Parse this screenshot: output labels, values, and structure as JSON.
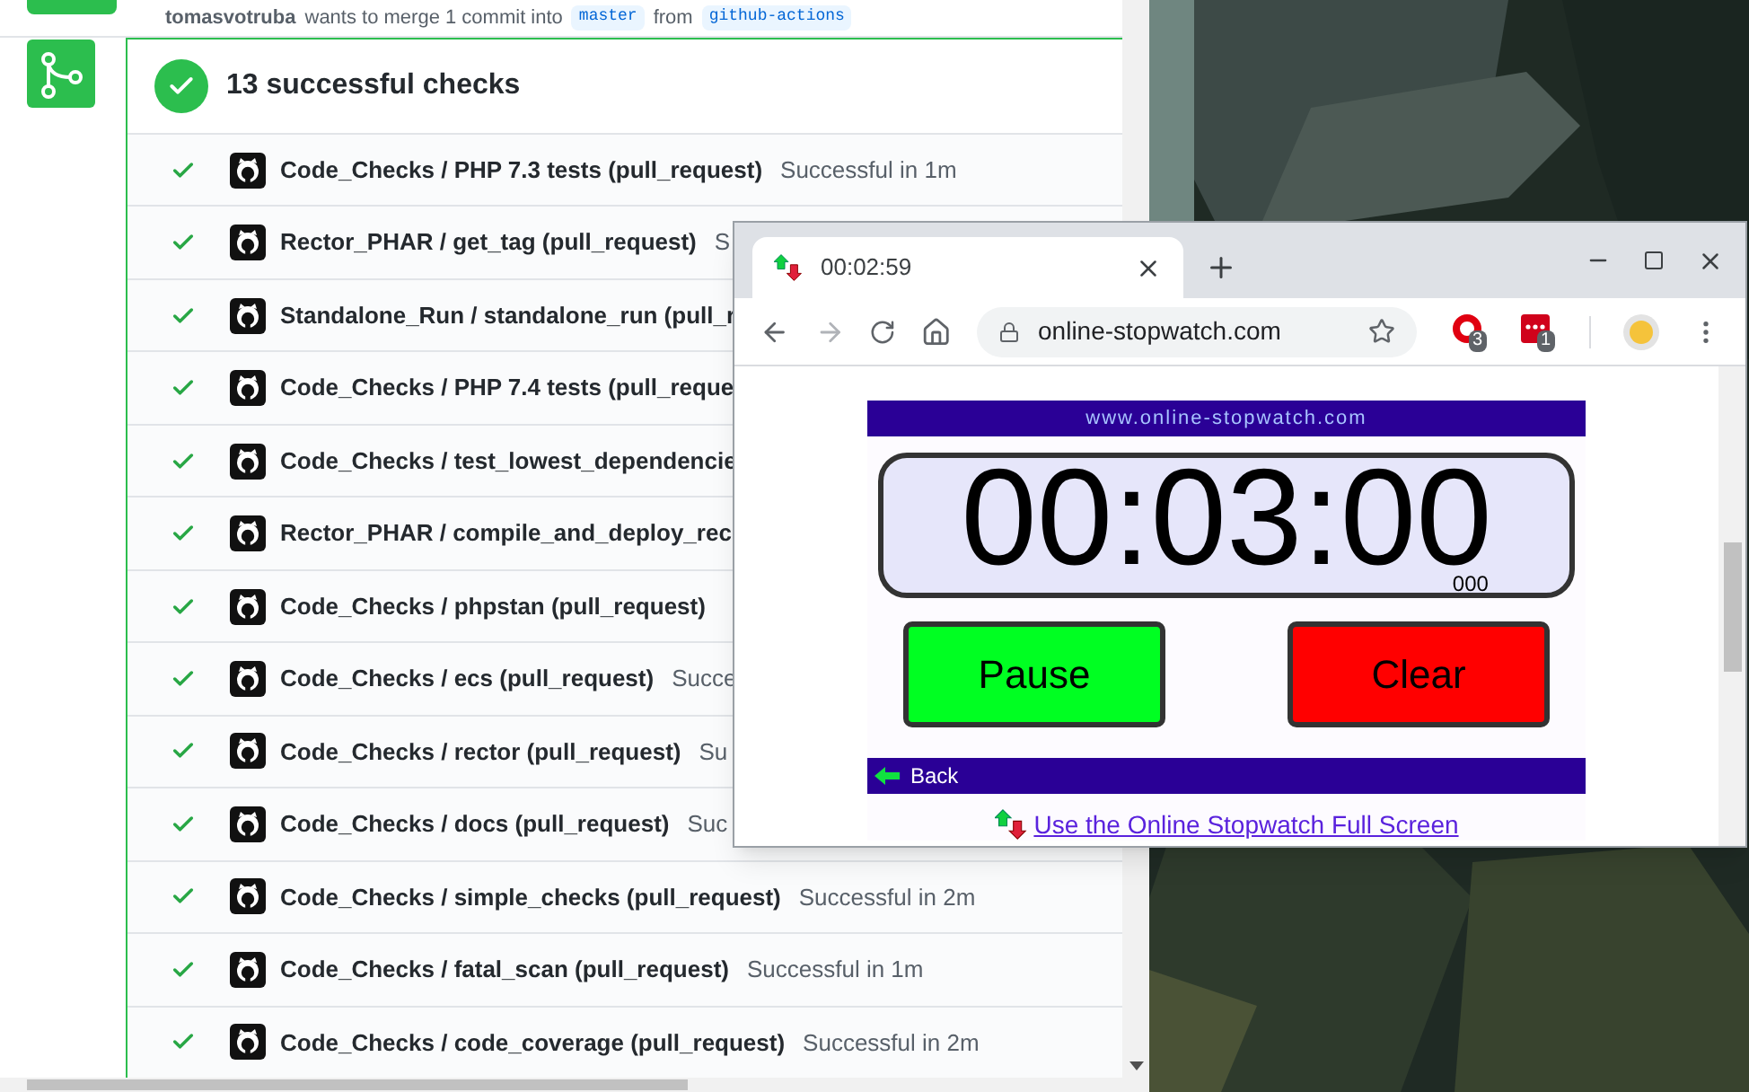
{
  "pr_header": {
    "author": "tomasvotruba",
    "action": "wants to merge 1 commit into",
    "base": "master",
    "from": "from",
    "head": "github-actions"
  },
  "checks": {
    "title": "13 successful checks",
    "items": [
      {
        "name": "Code_Checks / PHP 7.3 tests (pull_request)",
        "status": "Successful in 1m"
      },
      {
        "name": "Rector_PHAR / get_tag (pull_request)",
        "status": "S"
      },
      {
        "name": "Standalone_Run / standalone_run (pull_r"
      },
      {
        "name": "Code_Checks / PHP 7.4 tests (pull_reque"
      },
      {
        "name": "Code_Checks / test_lowest_dependencie"
      },
      {
        "name": "Rector_PHAR / compile_and_deploy_rec"
      },
      {
        "name": "Code_Checks / phpstan (pull_request)"
      },
      {
        "name": "Code_Checks / ecs (pull_request)",
        "status": "Succe"
      },
      {
        "name": "Code_Checks / rector (pull_request)",
        "status": "Su"
      },
      {
        "name": "Code_Checks / docs (pull_request)",
        "status": "Suc"
      },
      {
        "name": "Code_Checks / simple_checks (pull_request)",
        "status": "Successful in 2m"
      },
      {
        "name": "Code_Checks / fatal_scan (pull_request)",
        "status": "Successful in 1m"
      },
      {
        "name": "Code_Checks / code_coverage (pull_request)",
        "status": "Successful in 2m"
      }
    ]
  },
  "browser": {
    "tab_title": "00:02:59",
    "url": "online-stopwatch.com",
    "extensions": [
      {
        "kind": "ring",
        "badge": "3"
      },
      {
        "kind": "dots",
        "badge": "1"
      }
    ],
    "page": {
      "site_banner": "www.online-stopwatch.com",
      "time": "00:03:00",
      "milliseconds": "000",
      "buttons": [
        {
          "label": "Pause",
          "color": "#00ff22"
        },
        {
          "label": "Clear",
          "color": "#ff0000"
        }
      ],
      "back": "Back",
      "fullscreen_link": "Use the Online Stopwatch Full Screen"
    }
  }
}
